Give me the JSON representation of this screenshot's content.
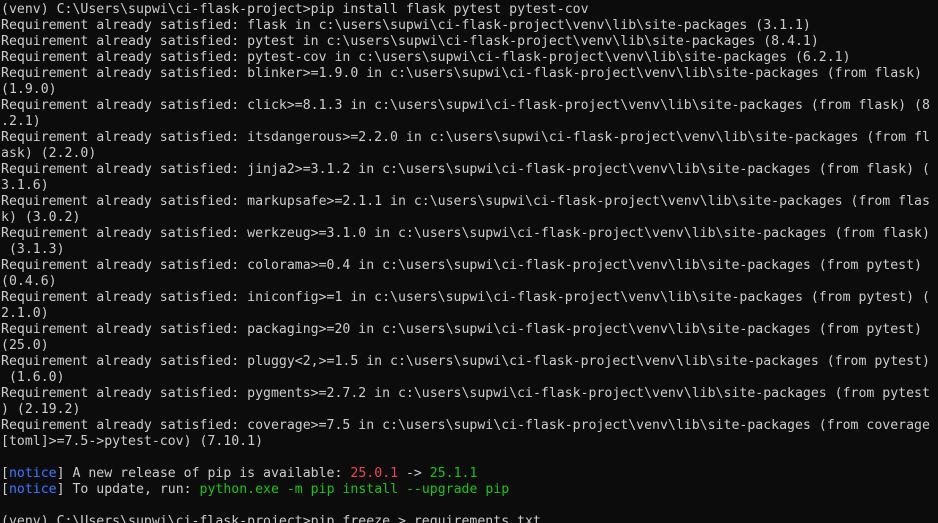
{
  "terminal": {
    "colors": {
      "background": "#0c0c0c",
      "foreground": "#cccccc",
      "notice": "#3b78ff",
      "old_version": "#e74856",
      "new_version": "#16c60c"
    },
    "lines": [
      "(venv) C:\\Users\\supwi\\ci-flask-project>pip install flask pytest pytest-cov",
      "Requirement already satisfied: flask in c:\\users\\supwi\\ci-flask-project\\venv\\lib\\site-packages (3.1.1)",
      "Requirement already satisfied: pytest in c:\\users\\supwi\\ci-flask-project\\venv\\lib\\site-packages (8.4.1)",
      "Requirement already satisfied: pytest-cov in c:\\users\\supwi\\ci-flask-project\\venv\\lib\\site-packages (6.2.1)",
      "Requirement already satisfied: blinker>=1.9.0 in c:\\users\\supwi\\ci-flask-project\\venv\\lib\\site-packages (from flask)",
      "(1.9.0)",
      "Requirement already satisfied: click>=8.1.3 in c:\\users\\supwi\\ci-flask-project\\venv\\lib\\site-packages (from flask) (8",
      ".2.1)",
      "Requirement already satisfied: itsdangerous>=2.2.0 in c:\\users\\supwi\\ci-flask-project\\venv\\lib\\site-packages (from fl",
      "ask) (2.2.0)",
      "Requirement already satisfied: jinja2>=3.1.2 in c:\\users\\supwi\\ci-flask-project\\venv\\lib\\site-packages (from flask) (",
      "3.1.6)",
      "Requirement already satisfied: markupsafe>=2.1.1 in c:\\users\\supwi\\ci-flask-project\\venv\\lib\\site-packages (from flas",
      "k) (3.0.2)",
      "Requirement already satisfied: werkzeug>=3.1.0 in c:\\users\\supwi\\ci-flask-project\\venv\\lib\\site-packages (from flask)",
      " (3.1.3)",
      "Requirement already satisfied: colorama>=0.4 in c:\\users\\supwi\\ci-flask-project\\venv\\lib\\site-packages (from pytest)",
      "(0.4.6)",
      "Requirement already satisfied: iniconfig>=1 in c:\\users\\supwi\\ci-flask-project\\venv\\lib\\site-packages (from pytest) (",
      "2.1.0)",
      "Requirement already satisfied: packaging>=20 in c:\\users\\supwi\\ci-flask-project\\venv\\lib\\site-packages (from pytest)",
      "(25.0)",
      "Requirement already satisfied: pluggy<2,>=1.5 in c:\\users\\supwi\\ci-flask-project\\venv\\lib\\site-packages (from pytest)",
      " (1.6.0)",
      "Requirement already satisfied: pygments>=2.7.2 in c:\\users\\supwi\\ci-flask-project\\venv\\lib\\site-packages (from pytest",
      ") (2.19.2)",
      "Requirement already satisfied: coverage>=7.5 in c:\\users\\supwi\\ci-flask-project\\venv\\lib\\site-packages (from coverage",
      "[toml]>=7.5->pytest-cov) (7.10.1)",
      ""
    ],
    "notice1": {
      "open": "[",
      "word": "notice",
      "close": "]",
      "text": " A new release of pip is available: ",
      "old_version": "25.0.1",
      "arrow": " -> ",
      "new_version": "25.1.1"
    },
    "notice2": {
      "open": "[",
      "word": "notice",
      "close": "]",
      "text": " To update, run: ",
      "command": "python.exe -m pip install --upgrade pip"
    },
    "blank_line": "",
    "last_line": "(venv) C:\\Users\\supwi\\ci-flask-project>pip freeze > requirements.txt"
  }
}
